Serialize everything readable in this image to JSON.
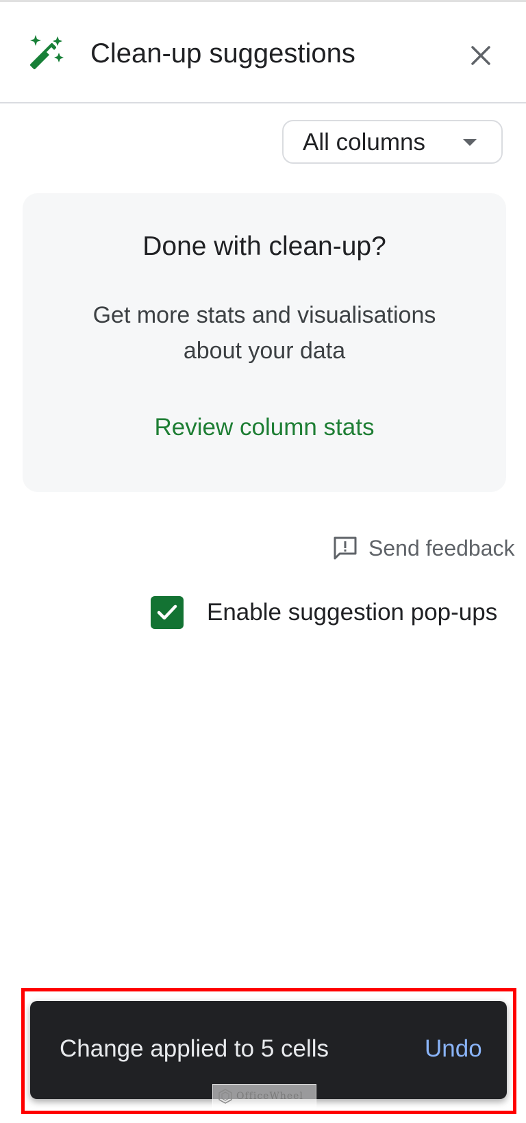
{
  "panel": {
    "title": "Clean-up suggestions",
    "icon": "magic-wand-icon",
    "close_icon": "close-icon"
  },
  "filter": {
    "selected": "All columns",
    "caret_icon": "dropdown-caret-icon"
  },
  "card": {
    "heading": "Done with clean-up?",
    "body": "Get more stats and visualisations about your data",
    "link_label": "Review column stats",
    "link_color": "#1e7e34"
  },
  "feedback": {
    "icon": "feedback-icon",
    "label": "Send feedback"
  },
  "popups_option": {
    "label": "Enable suggestion pop-ups",
    "checked": true,
    "accent": "#137333"
  },
  "snackbar": {
    "message": "Change applied to 5 cells",
    "action_label": "Undo",
    "action_color": "#8ab4f8"
  },
  "watermark": {
    "text": "OfficeWheel"
  }
}
